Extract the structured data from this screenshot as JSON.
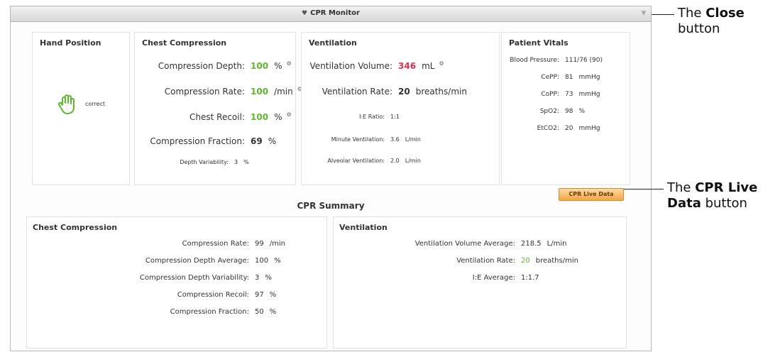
{
  "window": {
    "title": "CPR Monitor",
    "close_icon": "▼"
  },
  "hand": {
    "title": "Hand Position",
    "status": "correct"
  },
  "chest": {
    "title": "Chest Compression",
    "depth": {
      "label": "Compression Depth:",
      "value": "100",
      "unit": "%"
    },
    "rate": {
      "label": "Compression Rate:",
      "value": "100",
      "unit": "/min"
    },
    "recoil": {
      "label": "Chest Recoil:",
      "value": "100",
      "unit": "%"
    },
    "fraction": {
      "label": "Compression Fraction:",
      "value": "69",
      "unit": "%"
    },
    "variability": {
      "label": "Depth Variability:",
      "value": "3",
      "unit": "%"
    }
  },
  "vent": {
    "title": "Ventilation",
    "volume": {
      "label": "Ventilation Volume:",
      "value": "346",
      "unit": "mL"
    },
    "rate": {
      "label": "Ventilation Rate:",
      "value": "20",
      "unit": "breaths/min"
    },
    "ie": {
      "label": "I:E Ratio:",
      "value": "1:1"
    },
    "minute": {
      "label": "Minute Ventilation:",
      "value": "3.6",
      "unit": "L/min"
    },
    "alveolar": {
      "label": "Alveolar Ventilation:",
      "value": "2.0",
      "unit": "L/min"
    }
  },
  "vitals": {
    "title": "Patient Vitals",
    "bp": {
      "label": "Blood Pressure:",
      "value": "111/76 (90)"
    },
    "cepp": {
      "label": "CePP:",
      "value": "81",
      "unit": "mmHg"
    },
    "copp": {
      "label": "CoPP:",
      "value": "73",
      "unit": "mmHg"
    },
    "spo2": {
      "label": "SpO2:",
      "value": "98",
      "unit": "%"
    },
    "etco2": {
      "label": "EtCO2:",
      "value": "20",
      "unit": "mmHg"
    }
  },
  "live_button": "CPR Live Data",
  "summary": {
    "title": "CPR Summary",
    "chest": {
      "title": "Chest Compression",
      "rate": {
        "label": "Compression Rate:",
        "value": "99",
        "unit": "/min"
      },
      "depth_avg": {
        "label": "Compression Depth Average:",
        "value": "100",
        "unit": "%"
      },
      "depth_var": {
        "label": "Compression Depth Variability:",
        "value": "3",
        "unit": "%"
      },
      "recoil": {
        "label": "Compression Recoil:",
        "value": "97",
        "unit": "%"
      },
      "fraction": {
        "label": "Compression Fraction:",
        "value": "50",
        "unit": "%"
      }
    },
    "vent": {
      "title": "Ventilation",
      "volume_avg": {
        "label": "Ventilation Volume Average:",
        "value": "218.5",
        "unit": "L/min"
      },
      "rate": {
        "label": "Ventilation Rate:",
        "value": "20",
        "unit": "breaths/min"
      },
      "ie_avg": {
        "label": "I:E Average:",
        "value": "1:1.7"
      }
    }
  },
  "callouts": {
    "close": {
      "prefix": "The ",
      "bold": "Close",
      "suffix": "button"
    },
    "live": {
      "prefix": "The ",
      "bold": "CPR Live",
      "bold2": "Data",
      "suffix": " button"
    }
  },
  "colors": {
    "good": "#5cb82e",
    "alert": "#e0304a",
    "button": "#f3a746"
  }
}
